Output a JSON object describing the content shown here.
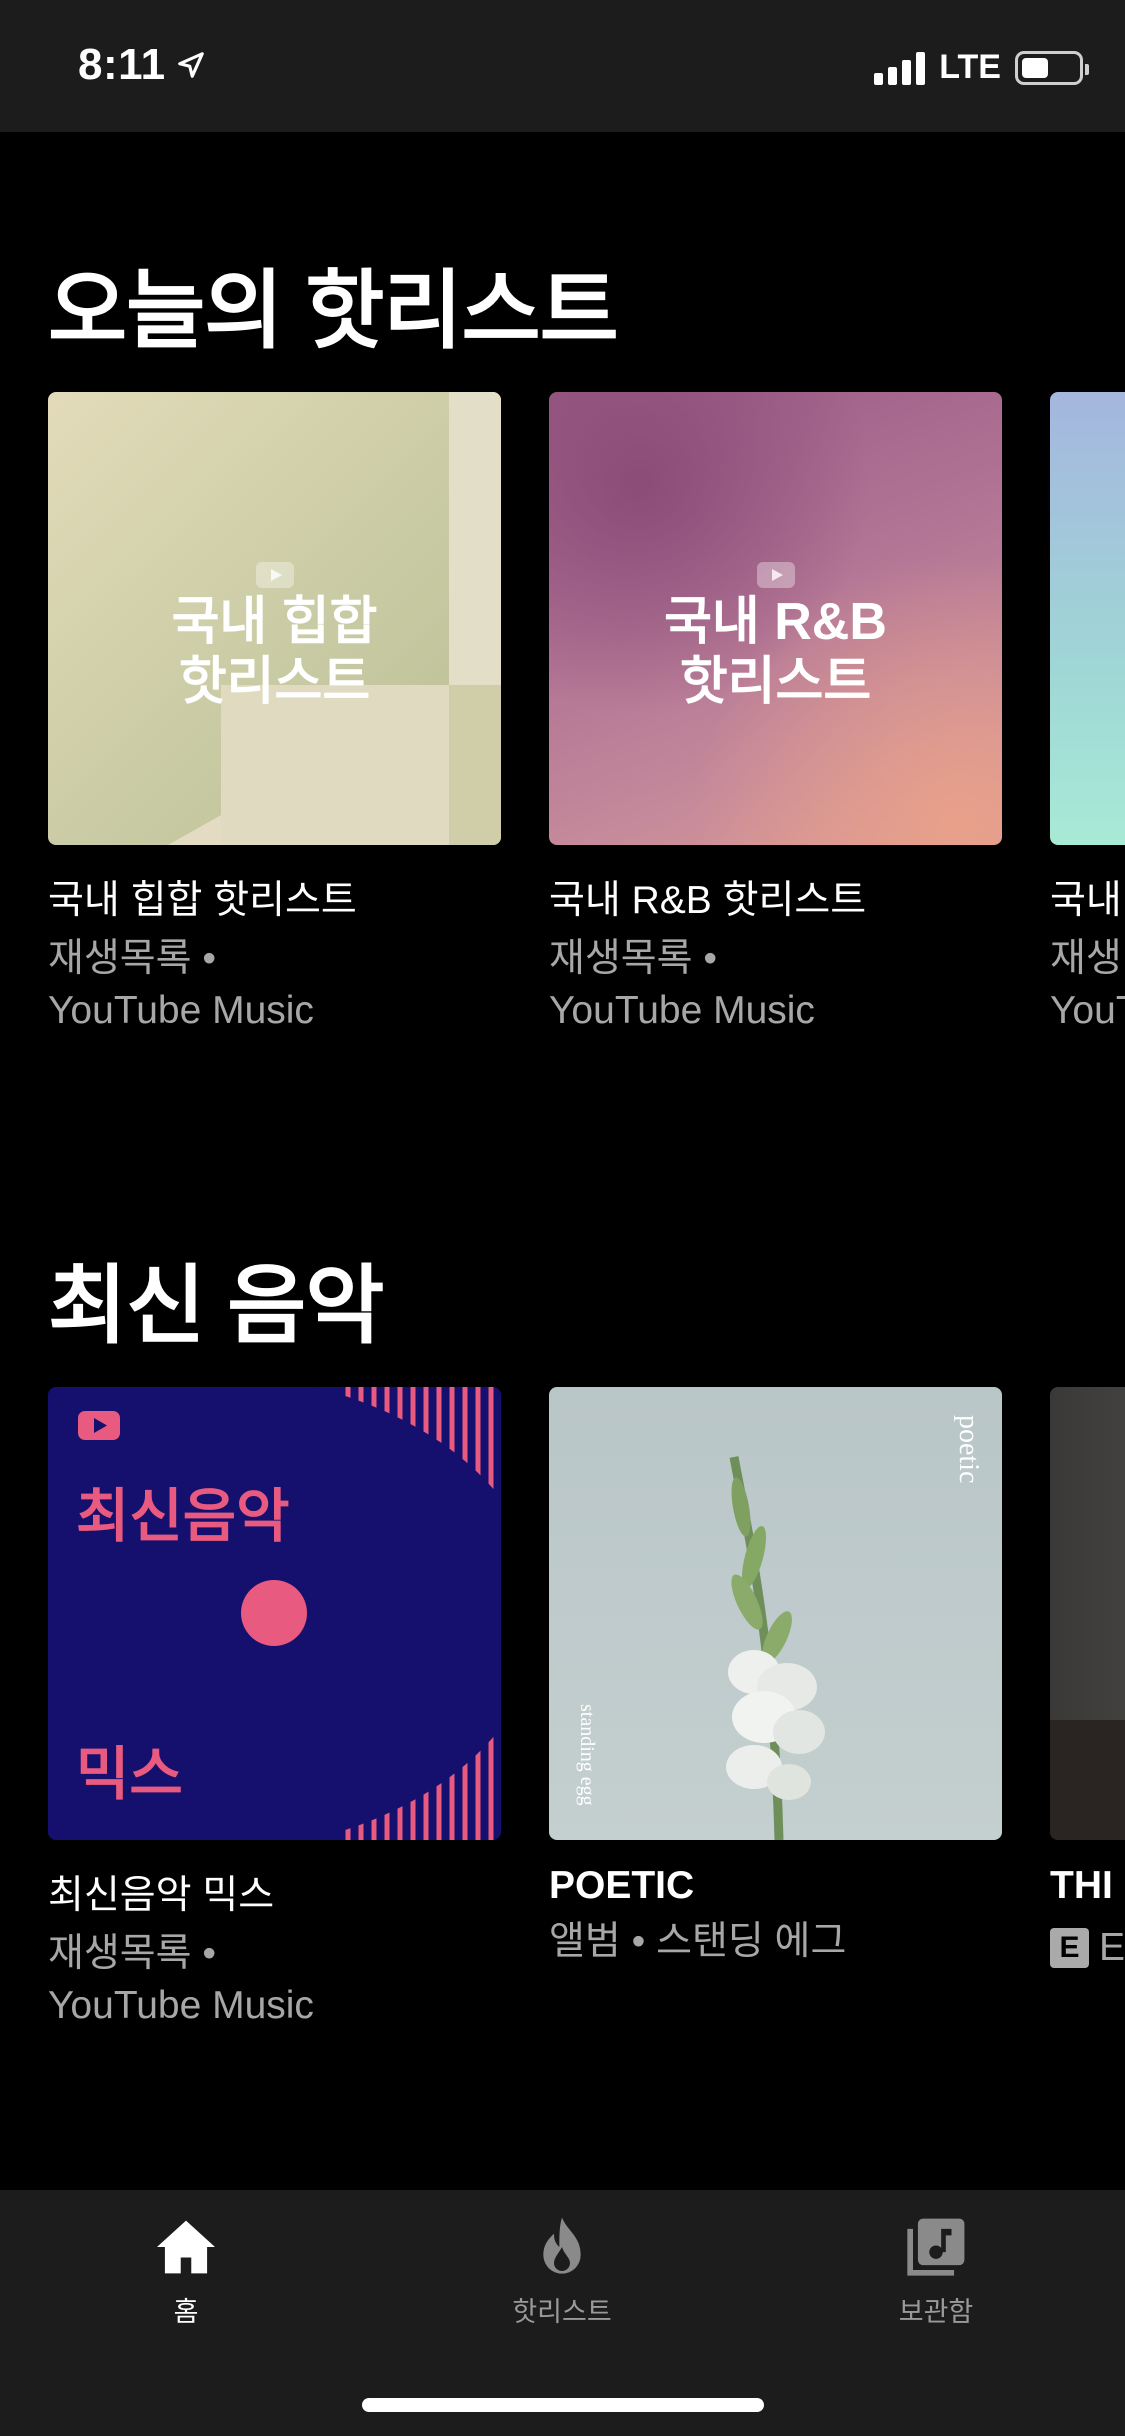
{
  "status": {
    "time": "8:11",
    "network": "LTE"
  },
  "sections": [
    {
      "title": "오늘의 핫리스트",
      "cards": [
        {
          "title": "국내 힙합 핫리스트",
          "subtitle_line1": "재생목록 •",
          "subtitle_line2": "YouTube Music",
          "thumb_text_line1": "국내 힙합",
          "thumb_text_line2": "핫리스트"
        },
        {
          "title": "국내 R&B 핫리스트",
          "subtitle_line1": "재생목록 •",
          "subtitle_line2": "YouTube Music",
          "thumb_text_line1": "국내 R&B",
          "thumb_text_line2": "핫리스트"
        },
        {
          "title": "국내",
          "subtitle_line1": "재생",
          "subtitle_line2": "YouT"
        }
      ]
    },
    {
      "title": "최신 음악",
      "cards": [
        {
          "title": "최신음악 믹스",
          "subtitle_line1": "재생목록 •",
          "subtitle_line2": "YouTube Music",
          "thumb_text_top": "최신음악",
          "thumb_text_bottom": "믹스"
        },
        {
          "title": "POETIC",
          "subtitle_line1": "앨범 • 스탠딩 에그",
          "thumb_text_right": "poetic",
          "thumb_text_left": "standing egg"
        },
        {
          "title": "THI",
          "explicit": "E",
          "subtitle_line1": "E"
        }
      ]
    }
  ],
  "tabs": [
    {
      "label": "홈",
      "icon": "home-icon",
      "active": true
    },
    {
      "label": "핫리스트",
      "icon": "flame-icon",
      "active": false
    },
    {
      "label": "보관함",
      "icon": "library-icon",
      "active": false
    }
  ],
  "colors": {
    "background": "#000000",
    "bar": "#1c1c1c",
    "secondary_text": "#a7a7a7",
    "mix_navy": "#15106e",
    "mix_pink": "#e85a7f"
  }
}
